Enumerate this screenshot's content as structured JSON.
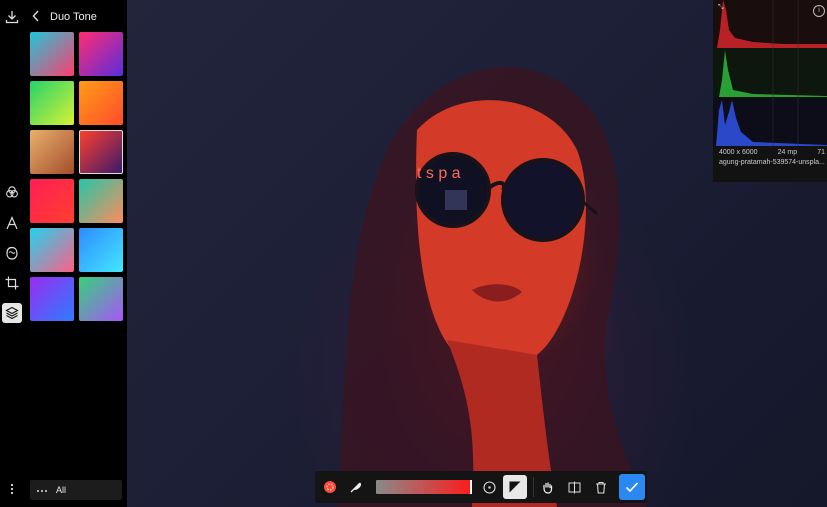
{
  "left_rail": {
    "icons": [
      "download-icon",
      "color-filter-icon",
      "text-icon",
      "mask-icon",
      "crop-icon",
      "layers-icon",
      "more-vertical-icon"
    ]
  },
  "panel": {
    "title": "Duo Tone",
    "presets": [
      [
        "#20c6d8",
        "#ff3d6e"
      ],
      [
        "#ff2d6f",
        "#5a2ddf"
      ],
      [
        "#24d36a",
        "#d8f135"
      ],
      [
        "#ff9d16",
        "#ff4b2b"
      ],
      [
        "#e9b06c",
        "#a34d2b"
      ],
      [
        "#ff3f2e",
        "#3a1a6a"
      ],
      [
        "#ff1e56",
        "#ff3f2e"
      ],
      [
        "#24c6a8",
        "#ff8c5a"
      ],
      [
        "#21d3f0",
        "#ff5f86"
      ],
      [
        "#2d8bff",
        "#44e7ff"
      ],
      [
        "#9a2cf0",
        "#2c7dff"
      ],
      [
        "#35d27a",
        "#a855f7"
      ]
    ],
    "selected_index": 5,
    "filter_label": "All",
    "filter_icon": "ellipsis-icon"
  },
  "image_info": {
    "dimensions": "4000 x 6000",
    "megapixels": "24 mp",
    "extra": "71",
    "filename": "agung-pratamah-539574-unspla..."
  },
  "toolbar": {
    "icons": [
      "brush-mask-icon",
      "feather-icon",
      "gradient-slider",
      "circle-icon",
      "exposure-icon",
      "hand-icon",
      "compare-icon",
      "trash-icon",
      "checkmark-icon"
    ],
    "slider_gradient": [
      "#8a8a8a",
      "#ff1a1a"
    ]
  },
  "colors": {
    "accent": "#2b88f0",
    "panel_bg": "#000000"
  }
}
